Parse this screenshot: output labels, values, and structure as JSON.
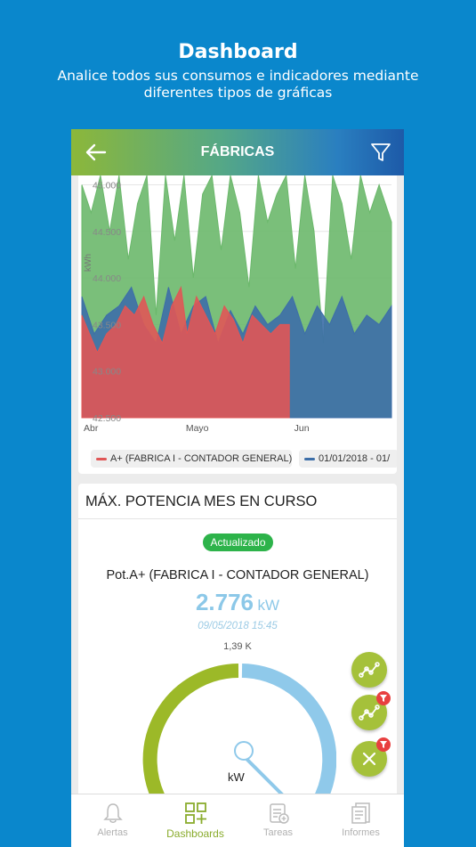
{
  "promo": {
    "title": "Dashboard",
    "subtitle_line1": "Analice todos sus consumos e indicadores mediante",
    "subtitle_line2": "diferentes tipos de gráficas"
  },
  "appbar": {
    "title": "FÁBRICAS",
    "back_icon": "arrow-left-icon",
    "filter_icon": "filter-icon"
  },
  "chart_data": {
    "type": "area",
    "ylabel": "kWh",
    "y_ticks": [
      "42.500",
      "43.000",
      "43.500",
      "44.000",
      "44.500",
      "45.000"
    ],
    "ylim": [
      42500,
      45100
    ],
    "x_ticks": [
      {
        "label": "Abr",
        "pos": 0.0
      },
      {
        "label": "Mayo",
        "pos": 0.33
      },
      {
        "label": "Jun",
        "pos": 0.68
      }
    ],
    "series": [
      {
        "name": "A+ (FABRICA I - CONTADOR GENERAL)",
        "color": "#e05656",
        "x": [
          0.0,
          0.05,
          0.08,
          0.11,
          0.14,
          0.17,
          0.2,
          0.23,
          0.26,
          0.29,
          0.32,
          0.34,
          0.37,
          0.4,
          0.43,
          0.46,
          0.49,
          0.52,
          0.55,
          0.58,
          0.61,
          0.64,
          0.67
        ],
        "values": [
          43600,
          43200,
          43400,
          43500,
          43700,
          43600,
          43800,
          43500,
          43300,
          43700,
          43900,
          43400,
          43800,
          43600,
          43400,
          43700,
          43550,
          43300,
          43600,
          43500,
          43400,
          43500,
          43500
        ]
      },
      {
        "name": "01/01/2018 - 01/...",
        "color": "#3d6ea8",
        "x": [
          0.0,
          0.04,
          0.08,
          0.12,
          0.16,
          0.2,
          0.24,
          0.28,
          0.32,
          0.36,
          0.4,
          0.44,
          0.48,
          0.52,
          0.56,
          0.6,
          0.64,
          0.68,
          0.72,
          0.76,
          0.8,
          0.84,
          0.88,
          0.92,
          0.96,
          1.0
        ],
        "values": [
          43800,
          43400,
          43600,
          43700,
          43900,
          43500,
          43300,
          43900,
          43400,
          43700,
          43800,
          43300,
          43650,
          43400,
          43700,
          43500,
          43600,
          43800,
          43400,
          43700,
          43500,
          43800,
          43400,
          43600,
          43500,
          43700
        ]
      },
      {
        "name": "green",
        "color": "#6bb86b",
        "x": [
          0.0,
          0.03,
          0.06,
          0.09,
          0.12,
          0.15,
          0.18,
          0.21,
          0.24,
          0.27,
          0.3,
          0.33,
          0.36,
          0.39,
          0.42,
          0.45,
          0.48,
          0.51,
          0.54,
          0.57,
          0.6,
          0.63,
          0.66,
          0.69,
          0.72,
          0.75,
          0.78,
          0.81,
          0.84,
          0.87,
          0.9,
          0.93,
          0.96,
          1.0
        ],
        "values": [
          45000,
          44700,
          45100,
          44500,
          45100,
          44200,
          44800,
          45100,
          43600,
          45100,
          44400,
          45100,
          44000,
          44900,
          45100,
          44300,
          45100,
          44700,
          43900,
          45100,
          44600,
          44900,
          45100,
          44100,
          45100,
          44500,
          43300,
          45100,
          44800,
          44200,
          45100,
          44700,
          45000,
          44600
        ]
      }
    ],
    "legend": [
      {
        "label": "A+ (FABRICA I - CONTADOR GENERAL)",
        "color": "#e05656"
      },
      {
        "label": "01/01/2018 - 01/",
        "color": "#3d6ea8"
      }
    ]
  },
  "max_card": {
    "title": "MÁX. POTENCIA MES EN CURSO",
    "badge": "Actualizado",
    "label": "Pot.A+ (FABRICA I - CONTADOR GENERAL)",
    "value": "2.776",
    "unit": "kW",
    "date": "09/05/2018 15:45",
    "max": "1,39 K",
    "gauge_unit": "kW",
    "gauge_colors": {
      "left": "#9cb928",
      "right": "#8fc9ea"
    }
  },
  "fabs": [
    {
      "icon": "line-chart-icon",
      "badge": false
    },
    {
      "icon": "line-chart-filter-icon",
      "badge": true
    },
    {
      "icon": "close-icon",
      "badge": true
    }
  ],
  "nav": [
    {
      "label": "Alertas",
      "icon": "bell-icon",
      "active": false
    },
    {
      "label": "Dashboards",
      "icon": "dashboard-grid-icon",
      "active": true
    },
    {
      "label": "Tareas",
      "icon": "tasks-icon",
      "active": false
    },
    {
      "label": "Informes",
      "icon": "reports-icon",
      "active": false
    }
  ]
}
